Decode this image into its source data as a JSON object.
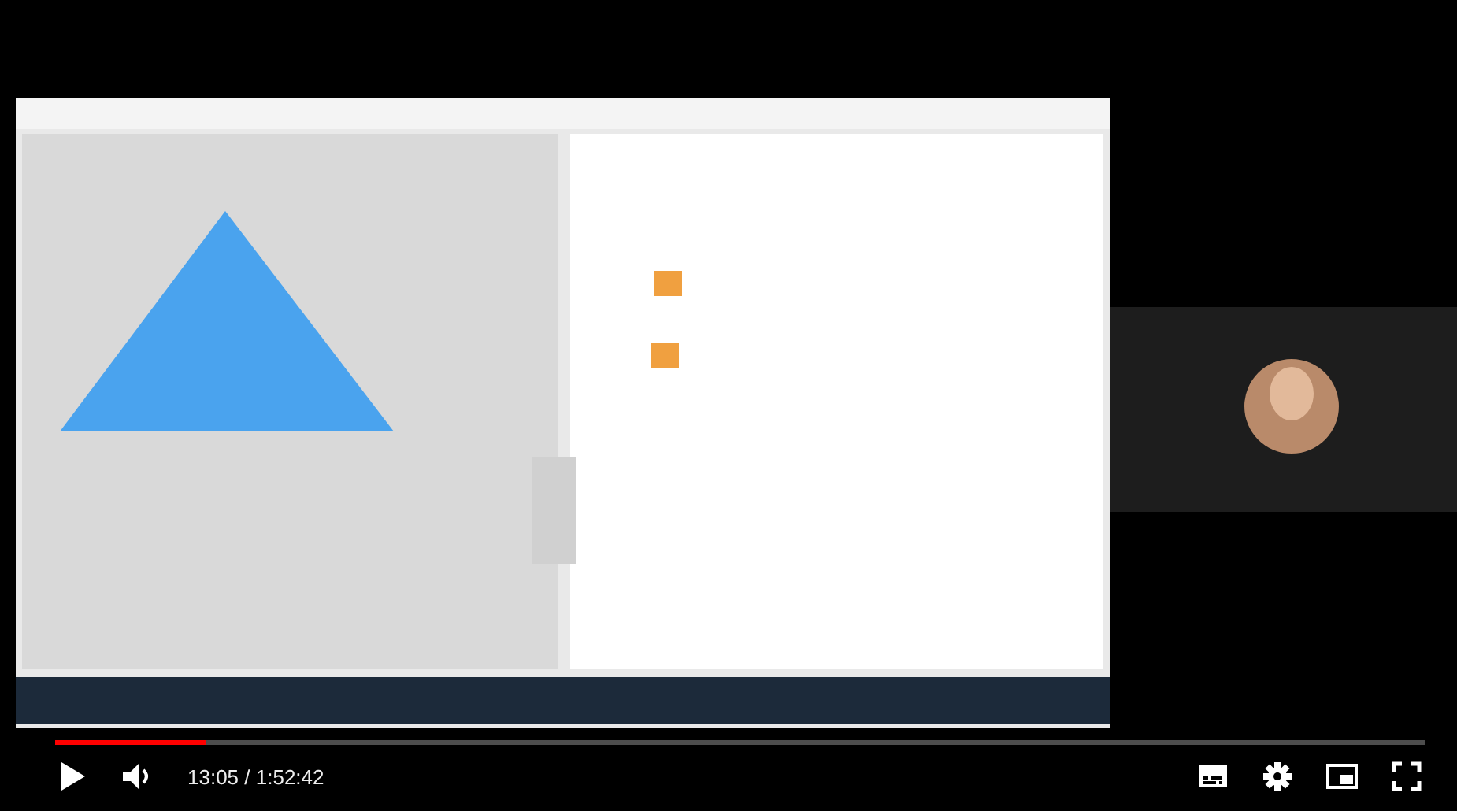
{
  "player": {
    "progress": {
      "level": 0.11
    },
    "time": "13:05 / 1:52:42",
    "playing": false,
    "muted": false
  }
}
